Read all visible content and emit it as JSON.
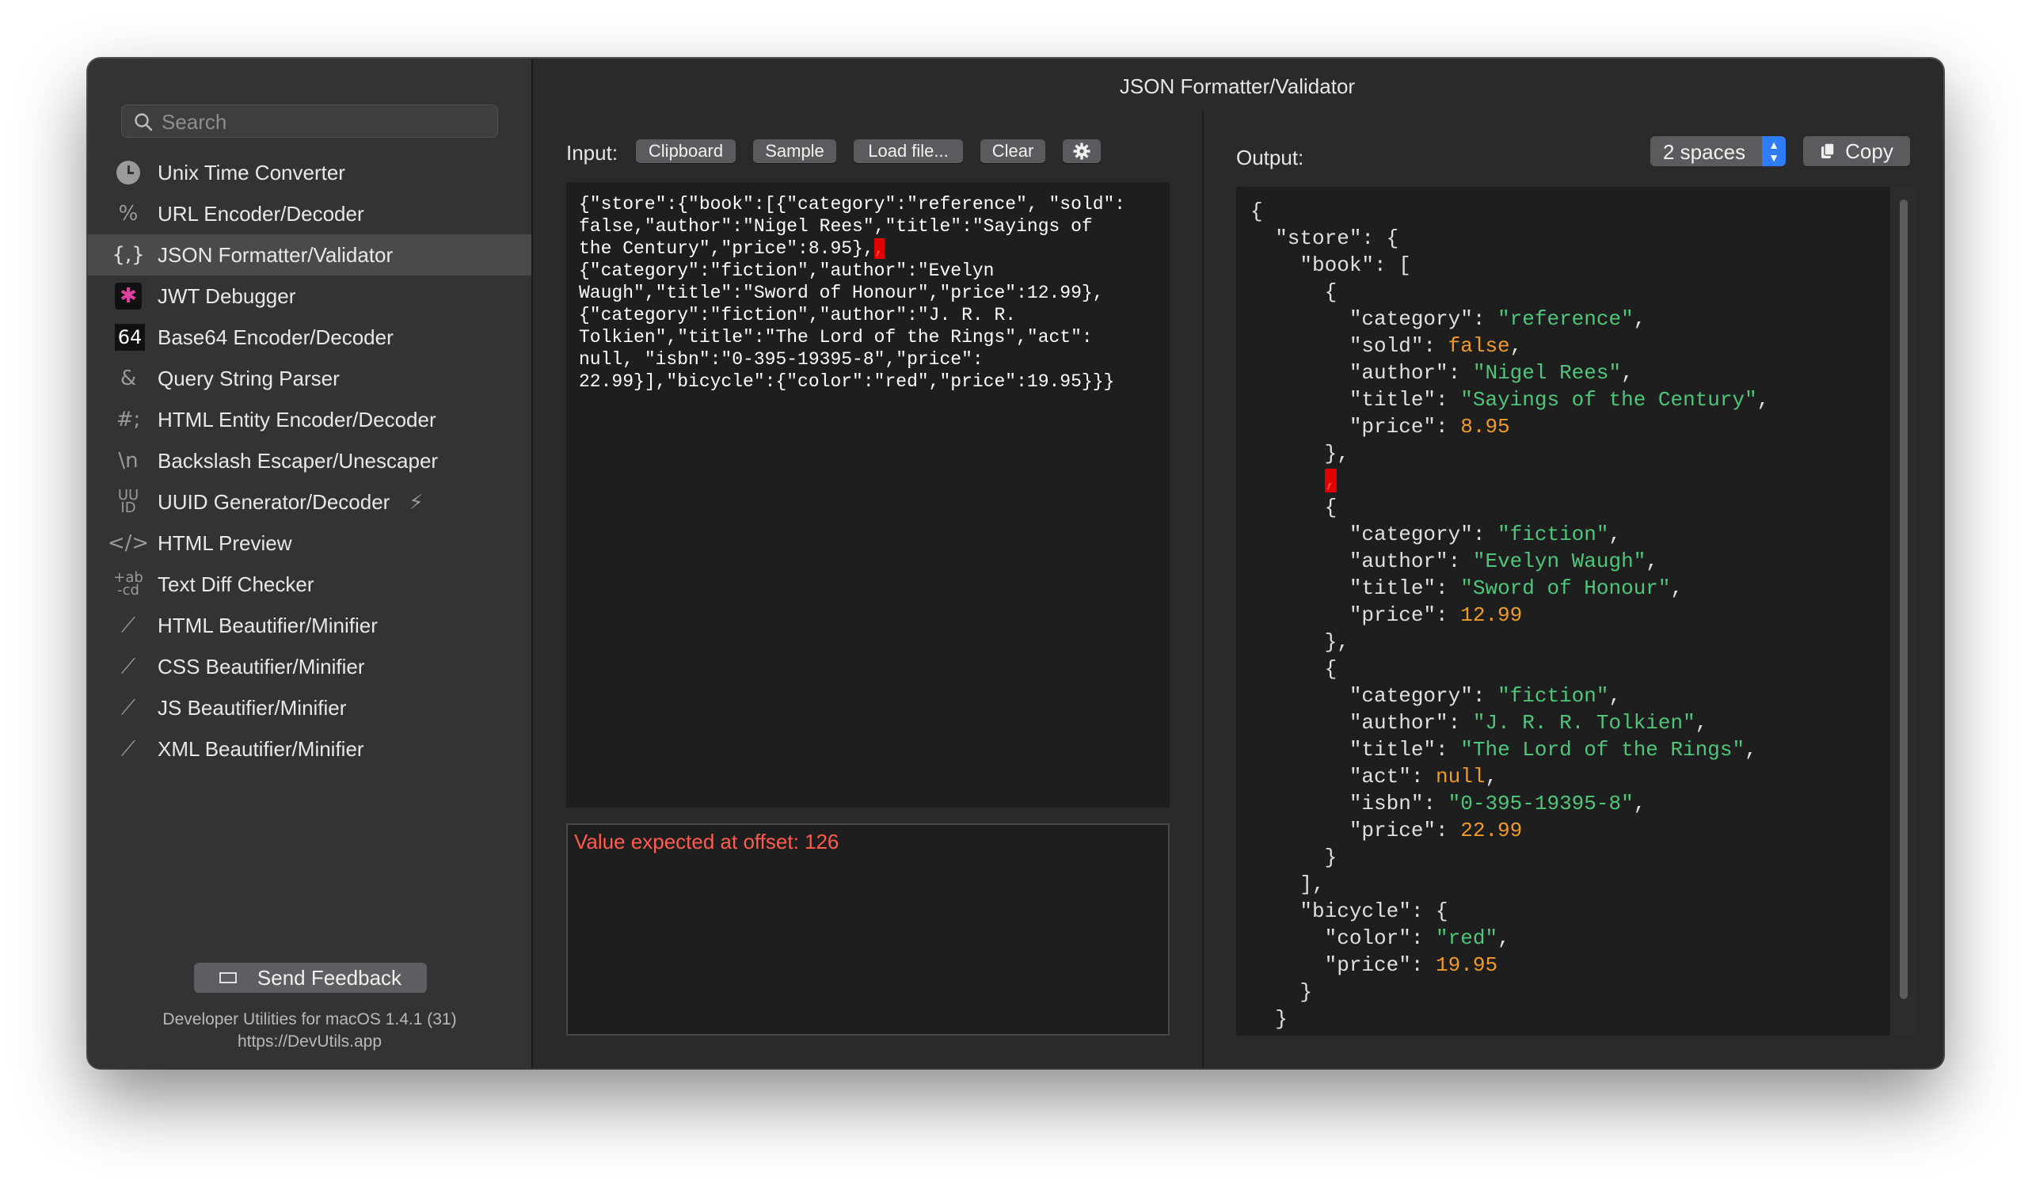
{
  "window": {
    "title": "JSON Formatter/Validator"
  },
  "sidebar": {
    "search_placeholder": "Search",
    "items": [
      {
        "label": "Unix Time Converter",
        "icon": "clock-icon",
        "glyph": ""
      },
      {
        "label": "URL Encoder/Decoder",
        "icon": "percent-icon",
        "glyph": "%"
      },
      {
        "label": "JSON Formatter/Validator",
        "icon": "braces-icon",
        "glyph": "{,}",
        "active": true
      },
      {
        "label": "JWT Debugger",
        "icon": "jwt-icon",
        "glyph": "✱"
      },
      {
        "label": "Base64 Encoder/Decoder",
        "icon": "base64-icon",
        "glyph": "64"
      },
      {
        "label": "Query String Parser",
        "icon": "ampersand-icon",
        "glyph": "&"
      },
      {
        "label": "HTML Entity Encoder/Decoder",
        "icon": "hash-icon",
        "glyph": "#;"
      },
      {
        "label": "Backslash Escaper/Unescaper",
        "icon": "backslash-icon",
        "glyph": "\\n"
      },
      {
        "label": "UUID Generator/Decoder",
        "icon": "uuid-icon",
        "glyph": "UU\nID",
        "extra": "⚡"
      },
      {
        "label": "HTML Preview",
        "icon": "code-icon",
        "glyph": "</>"
      },
      {
        "label": "Text Diff Checker",
        "icon": "diff-icon",
        "glyph": "+ab\n-cd"
      },
      {
        "label": "HTML Beautifier/Minifier",
        "icon": "magic-wand-icon",
        "glyph": "⟋"
      },
      {
        "label": "CSS Beautifier/Minifier",
        "icon": "magic-wand-icon",
        "glyph": "⟋"
      },
      {
        "label": "JS Beautifier/Minifier",
        "icon": "magic-wand-icon",
        "glyph": "⟋"
      },
      {
        "label": "XML Beautifier/Minifier",
        "icon": "magic-wand-icon",
        "glyph": "⟋"
      }
    ],
    "feedback_label": "Send Feedback",
    "version_line1": "Developer Utilities for macOS 1.4.1 (31)",
    "version_line2": "https://DevUtils.app"
  },
  "input": {
    "label": "Input:",
    "buttons": {
      "clipboard": "Clipboard",
      "sample": "Sample",
      "load": "Load file...",
      "clear": "Clear"
    },
    "text_before_error": "{\"store\":{\"book\":[{\"category\":\"reference\", \"sold\":\nfalse,\"author\":\"Nigel Rees\",\"title\":\"Sayings of\nthe Century\",\"price\":8.95},",
    "error_char": ",",
    "text_after_error": "\n{\"category\":\"fiction\",\"author\":\"Evelyn\nWaugh\",\"title\":\"Sword of Honour\",\"price\":12.99},\n{\"category\":\"fiction\",\"author\":\"J. R. R.\nTolkien\",\"title\":\"The Lord of the Rings\",\"act\":\nnull, \"isbn\":\"0-395-19395-8\",\"price\":\n22.99}],\"bicycle\":{\"color\":\"red\",\"price\":19.95}}}",
    "error_message": "Value expected at offset: 126"
  },
  "output": {
    "label": "Output:",
    "indent_option": "2 spaces",
    "copy_label": "Copy",
    "books": [
      {
        "category": "reference",
        "sold": "false",
        "author": "Nigel Rees",
        "title": "Sayings of the Century",
        "price": "8.95"
      },
      {
        "category": "fiction",
        "author": "Evelyn Waugh",
        "title": "Sword of Honour",
        "price": "12.99"
      },
      {
        "category": "fiction",
        "author": "J. R. R. Tolkien",
        "title": "The Lord of the Rings",
        "act": "null",
        "isbn": "0-395-19395-8",
        "price": "22.99"
      }
    ],
    "bicycle": {
      "color": "red",
      "price": "19.95"
    },
    "error_char": ","
  },
  "colors": {
    "string": "#4fc67a",
    "number": "#f09a2a",
    "error": "#ff5b4f",
    "accent": "#2f7df6"
  }
}
